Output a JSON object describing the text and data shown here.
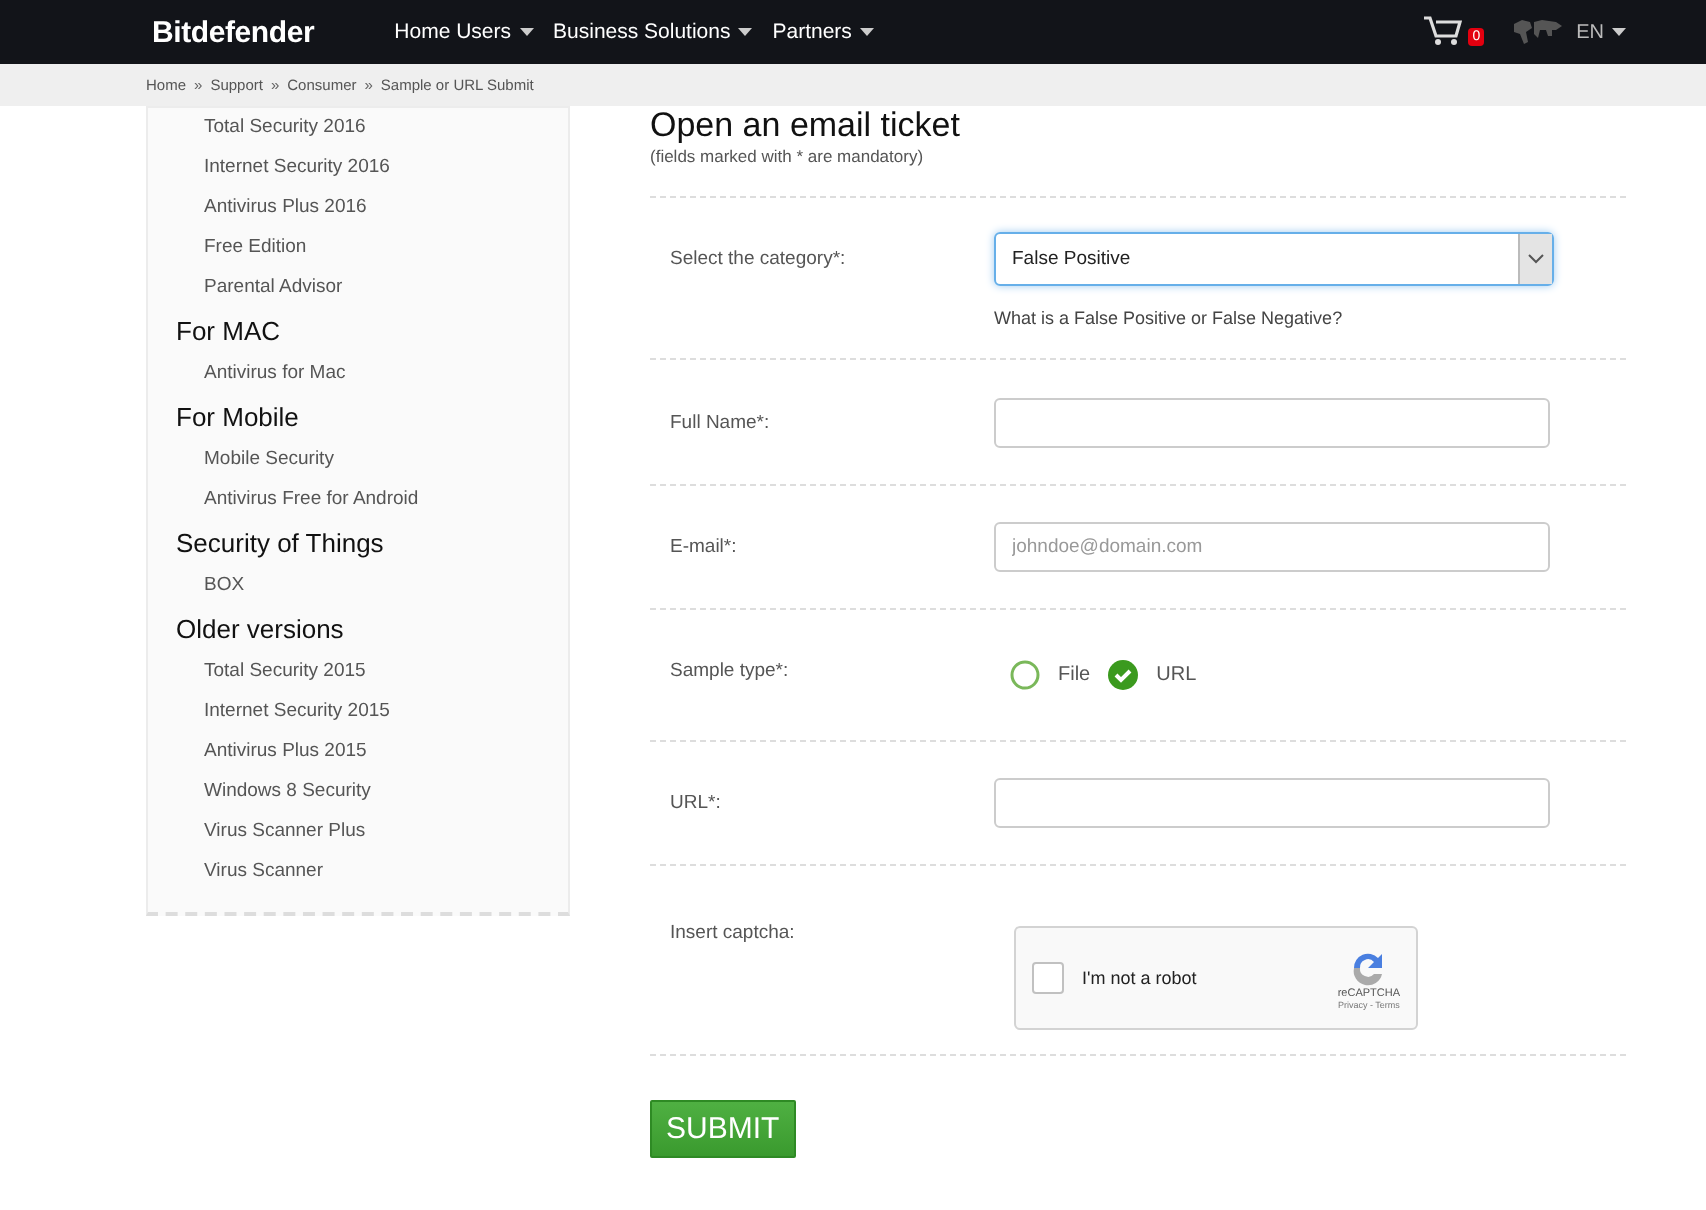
{
  "header": {
    "logo": "Bitdefender",
    "nav": [
      {
        "label": "Home Users"
      },
      {
        "label": "Business Solutions"
      },
      {
        "label": "Partners"
      }
    ],
    "cart_count": "0",
    "language": "EN"
  },
  "breadcrumb": {
    "separator": "»",
    "items": [
      "Home",
      "Support",
      "Consumer",
      "Sample or URL Submit"
    ]
  },
  "sidebar": {
    "groups": [
      {
        "items": [
          "Total Security 2016",
          "Internet Security 2016",
          "Antivirus Plus 2016",
          "Free Edition",
          "Parental Advisor"
        ]
      },
      {
        "title": "For MAC",
        "items": [
          "Antivirus for Mac"
        ]
      },
      {
        "title": "For Mobile",
        "items": [
          "Mobile Security",
          "Antivirus Free for Android"
        ]
      },
      {
        "title": "Security of Things",
        "items": [
          "BOX"
        ]
      },
      {
        "title": "Older versions",
        "items": [
          "Total Security 2015",
          "Internet Security 2015",
          "Antivirus Plus 2015",
          "Windows 8 Security",
          "Virus Scanner Plus",
          "Virus Scanner"
        ]
      }
    ]
  },
  "form": {
    "title": "Open an email ticket",
    "note": "(fields marked with * are mandatory)",
    "rows": [
      {
        "kind": "select",
        "label": "Select the category*:",
        "value": "False Positive",
        "help": "What is a False Positive or False Negative?"
      },
      {
        "kind": "text",
        "label": "Full Name*:"
      },
      {
        "kind": "text",
        "label": "E-mail*:",
        "placeholder": "johndoe@domain.com"
      },
      {
        "kind": "radio",
        "label": "Sample type*:",
        "options": [
          {
            "label": "File",
            "selected": false
          },
          {
            "label": "URL",
            "selected": true
          }
        ]
      },
      {
        "kind": "text",
        "label": "URL*:"
      },
      {
        "kind": "captcha",
        "label": "Insert captcha:",
        "checkbox_label": "I'm not a robot",
        "checked": false,
        "brand": "reCAPTCHA",
        "links": "Privacy - Terms"
      }
    ],
    "submit": "SUBMIT"
  }
}
